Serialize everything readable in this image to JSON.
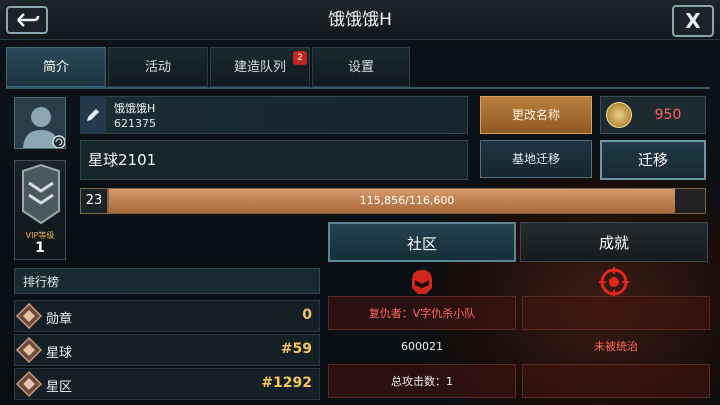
{
  "title": "饿饿饿H",
  "close_label": "X",
  "tabs": [
    {
      "label": "简介",
      "active": true
    },
    {
      "label": "活动"
    },
    {
      "label": "建造队列",
      "badge": "2"
    },
    {
      "label": "设置"
    }
  ],
  "profile": {
    "name": "饿饿饿H",
    "id": "621375",
    "planet": "星球2101",
    "rename_label": "更改名称",
    "coins": "950",
    "relocate_label": "基地迁移",
    "migrate_label": "迁移",
    "level": "23",
    "exp_text": "115,856/116,600",
    "exp_progress": 0.9936,
    "vip_label": "VIP等级",
    "vip_level": "1"
  },
  "social": {
    "community_label": "社区",
    "achievement_label": "成就",
    "alliance": "复仇者：V字仇杀小队",
    "alliance_id": "600021",
    "attacks": "总攻击数：1",
    "status": "未被统治"
  },
  "ranking": {
    "heading": "排行榜",
    "rows": [
      {
        "label": "勋章",
        "value": "0"
      },
      {
        "label": "星球",
        "value": "#59"
      },
      {
        "label": "星区",
        "value": "#1292"
      }
    ]
  },
  "colors": {
    "accent": "#b9803e",
    "danger": "#ff6a5a",
    "rank_value": "#f6c65a"
  }
}
